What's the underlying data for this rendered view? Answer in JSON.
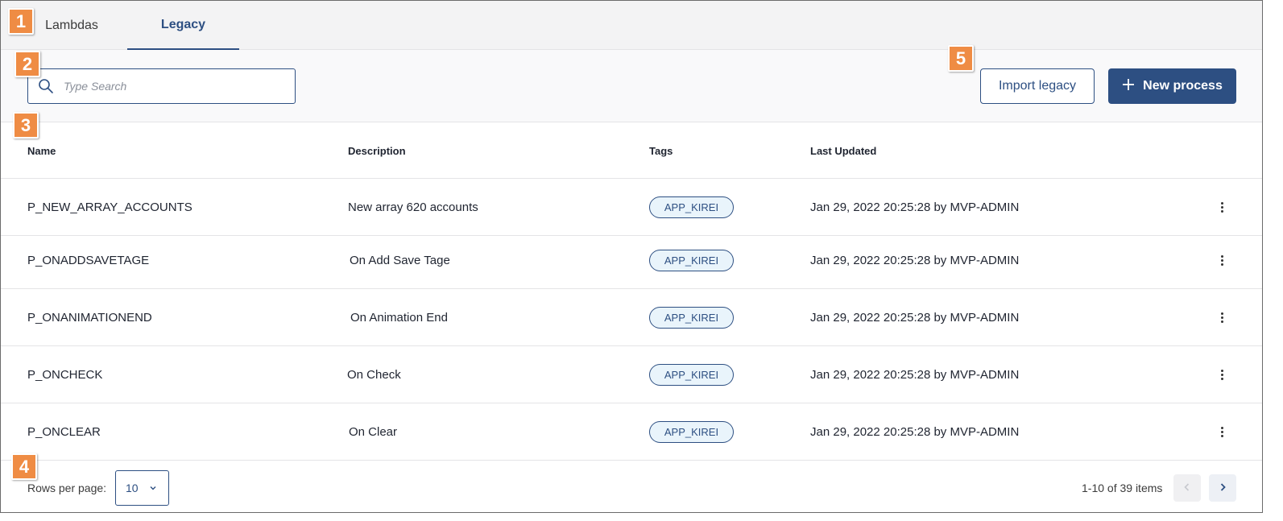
{
  "tabs": [
    {
      "label": "Lambdas",
      "active": false
    },
    {
      "label": "Legacy",
      "active": true
    }
  ],
  "search": {
    "placeholder": "Type Search",
    "value": ""
  },
  "toolbar": {
    "import_label": "Import legacy",
    "new_label": "New process"
  },
  "table": {
    "columns": [
      "Name",
      "Description",
      "Tags",
      "Last Updated"
    ],
    "rows": [
      {
        "name": "P_NEW_ARRAY_ACCOUNTS",
        "description": "New array 620 accounts",
        "tag": "APP_KIREI",
        "updated": "Jan 29, 2022 20:25:28 by MVP-ADMIN"
      },
      {
        "name": "P_ONADDSAVETAGE",
        "description": "On Add Save Tage",
        "tag": "APP_KIREI",
        "updated": "Jan 29, 2022 20:25:28 by MVP-ADMIN"
      },
      {
        "name": "P_ONANIMATIONEND",
        "description": "On Animation End",
        "tag": "APP_KIREI",
        "updated": "Jan 29, 2022 20:25:28 by MVP-ADMIN"
      },
      {
        "name": "P_ONCHECK",
        "description": "On Check",
        "tag": "APP_KIREI",
        "updated": "Jan 29, 2022 20:25:28 by MVP-ADMIN"
      },
      {
        "name": "P_ONCLEAR",
        "description": "On Clear",
        "tag": "APP_KIREI",
        "updated": "Jan 29, 2022 20:25:28 by MVP-ADMIN"
      }
    ]
  },
  "footer": {
    "rows_per_page_label": "Rows per page:",
    "rows_per_page_value": "10",
    "range_text": "1-10 of 39 items"
  },
  "badges": [
    "1",
    "2",
    "3",
    "4",
    "5"
  ],
  "icons": {
    "search": "search-icon",
    "plus": "plus-icon",
    "chevron_down": "chevron-down-icon",
    "chevron_left": "chevron-left-icon",
    "chevron_right": "chevron-right-icon",
    "more": "more-vertical-icon"
  },
  "colors": {
    "accent": "#2d4f82",
    "badge": "#ef8c44",
    "tag_bg": "#e9f4fb"
  }
}
